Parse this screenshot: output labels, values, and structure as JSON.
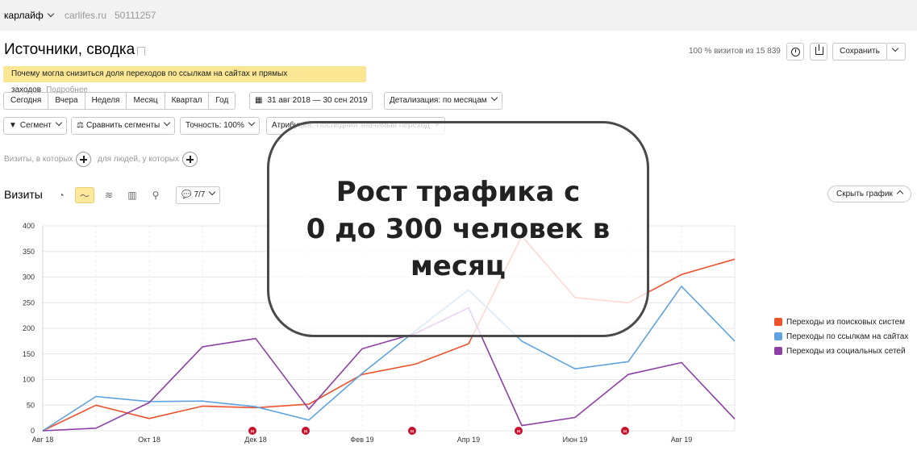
{
  "header": {
    "counter": "карлайф",
    "site": "carlifes.ru",
    "counter_id": "50111257"
  },
  "page": {
    "title": "Источники, сводка",
    "visits_share": "100 % визитов из 15 839",
    "save_label": "Сохранить"
  },
  "notice": {
    "text": "Почему могла снизиться доля переходов по ссылкам на сайтах и прямых заходов",
    "more": "Подробнее"
  },
  "periods": [
    "Сегодня",
    "Вчера",
    "Неделя",
    "Месяц",
    "Квартал",
    "Год"
  ],
  "date_range": "31 авг 2018 — 30 сен 2019",
  "detail": "Детализация: по месяцам",
  "toolbar": {
    "segment": "Сегмент",
    "compare": "Сравнить сегменты",
    "accuracy": "Точность: 100%",
    "attribution": "Атрибуция: Последний значимый переход"
  },
  "filters": {
    "visits_which": "Визиты, в которых",
    "people_which": "для людей, у которых"
  },
  "chart_header": {
    "label": "Визиты",
    "series_count": "7/7",
    "hide": "Скрыть график"
  },
  "overlay": {
    "line1": "Рост трафика с",
    "line2": "0 до 300 человек в",
    "line3": "месяц"
  },
  "chart_data": {
    "type": "line",
    "x": [
      "Авг 18",
      "Сен 18",
      "Окт 18",
      "Ноя 18",
      "Дек 18",
      "Янв 19",
      "Фев 19",
      "Мар 19",
      "Апр 19",
      "Май 19",
      "Июн 19",
      "Июл 19",
      "Авг 19",
      "Сен 19"
    ],
    "xticks": [
      "Авг 18",
      "Окт 18",
      "Дек 18",
      "Фев 19",
      "Апр 19",
      "Июн 19",
      "Авг 19"
    ],
    "ylim": [
      0,
      400
    ],
    "yticks": [
      "0",
      "50",
      "100",
      "150",
      "200",
      "250",
      "300",
      "350",
      "400"
    ],
    "grid": true,
    "legend_position": "right",
    "series": [
      {
        "name": "Переходы из поисковых систем",
        "color": "#f0522d",
        "values": [
          0,
          50,
          24,
          48,
          45,
          52,
          110,
          130,
          170,
          380,
          260,
          250,
          305,
          335
        ]
      },
      {
        "name": "Переходы по ссылкам на сайтах",
        "color": "#5ea3df",
        "values": [
          0,
          67,
          57,
          58,
          47,
          21,
          112,
          195,
          275,
          175,
          121,
          135,
          282,
          175
        ]
      },
      {
        "name": "Переходы из социальных сетей",
        "color": "#8e3fa5",
        "values": [
          0,
          5,
          55,
          164,
          180,
          42,
          160,
          190,
          240,
          10,
          26,
          110,
          133,
          23
        ]
      }
    ],
    "markers_label": "м",
    "markers_at": [
      "Дек 18",
      "Янв 19",
      "Мар 19",
      "Май 19",
      "Июл 19"
    ]
  }
}
